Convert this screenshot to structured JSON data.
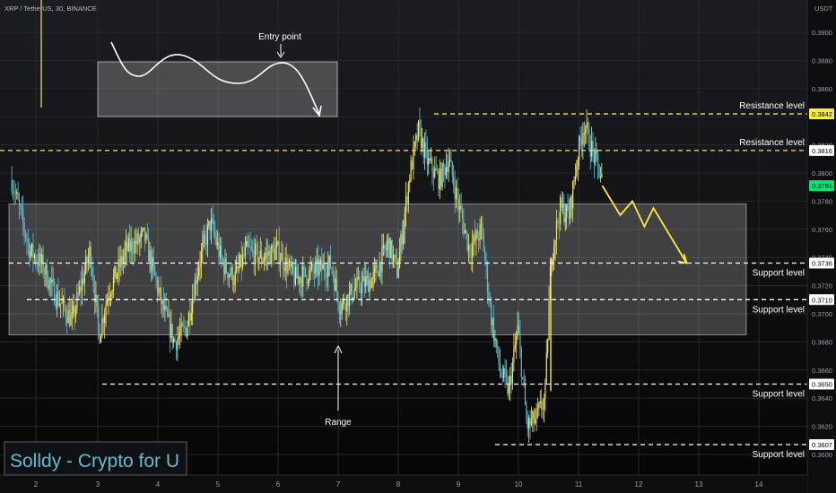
{
  "header": {
    "symbol_line": "XRP / TetherUS, 30, BINANCE"
  },
  "watermark": {
    "text": "Solldy - Crypto for U"
  },
  "price_axis": {
    "unit": "USDT",
    "ticks": [
      "0.3900",
      "0.3880",
      "0.3860",
      "0.3840",
      "0.3820",
      "0.3800",
      "0.3780",
      "0.3760",
      "0.3740",
      "0.3720",
      "0.3700",
      "0.3680",
      "0.3660",
      "0.3640",
      "0.3620",
      "0.3600"
    ]
  },
  "time_axis": {
    "labels": [
      "2",
      "3",
      "4",
      "5",
      "6",
      "7",
      "8",
      "9",
      "10",
      "11",
      "12",
      "13",
      "14"
    ]
  },
  "price_tags": [
    {
      "label": "0.3842",
      "value": 0.3842,
      "bg": "#ffeb3b",
      "fg": "#000000"
    },
    {
      "label": "0.3816",
      "value": 0.3816,
      "bg": "#ffffff",
      "fg": "#000000"
    },
    {
      "label": "0.3791",
      "value": 0.3791,
      "bg": "#00e676",
      "fg": "#000000"
    },
    {
      "label": "0.3736",
      "value": 0.3736,
      "bg": "#ffffff",
      "fg": "#000000"
    },
    {
      "label": "0.3710",
      "value": 0.371,
      "bg": "#ffffff",
      "fg": "#000000"
    },
    {
      "label": "0.3650",
      "value": 0.365,
      "bg": "#ffffff",
      "fg": "#000000"
    },
    {
      "label": "0.3607",
      "value": 0.3607,
      "bg": "#ffffff",
      "fg": "#000000"
    }
  ],
  "annotations": {
    "entry_point": "Entry point",
    "range": "Range",
    "resistance_1": "Resistance level",
    "resistance_2": "Resistance level",
    "support_1": "Support level",
    "support_2": "Support level",
    "support_3": "Support level",
    "support_4": "Support level"
  },
  "colors": {
    "background": "#0b0b0d",
    "bull": "#f5e663",
    "bear": "#5fbcd3",
    "resistance_line": "#ffeb3b",
    "support_line": "#ffffff",
    "projection": "#ffeb3b",
    "watermark": "#5fbcd3"
  },
  "chart_data": {
    "type": "line",
    "title": "XRP / TetherUS, 30, BINANCE",
    "ylabel": "USDT",
    "ylim": [
      0.3592,
      0.3915
    ],
    "x_labels": [
      "2",
      "3",
      "4",
      "5",
      "6",
      "7",
      "8",
      "9",
      "10",
      "11",
      "12",
      "13",
      "14"
    ],
    "series": [
      {
        "name": "XRP / TetherUS",
        "x": [
          1.6,
          1.9,
          2.1,
          2.3,
          2.6,
          2.9,
          3.05,
          3.2,
          3.5,
          3.8,
          4.1,
          4.3,
          4.5,
          4.7,
          4.9,
          5.1,
          5.3,
          5.5,
          5.75,
          6.0,
          6.3,
          6.6,
          6.9,
          7.05,
          7.3,
          7.6,
          7.85,
          8.0,
          8.2,
          8.35,
          8.5,
          8.7,
          8.85,
          9.0,
          9.2,
          9.4,
          9.55,
          9.7,
          9.85,
          10.0,
          10.15,
          10.3,
          10.45,
          10.55,
          10.7,
          10.85,
          11.0,
          11.1,
          11.2,
          11.4
        ],
        "values": [
          0.3795,
          0.3745,
          0.3735,
          0.3715,
          0.3695,
          0.3745,
          0.3685,
          0.3715,
          0.3745,
          0.3755,
          0.3705,
          0.368,
          0.369,
          0.3735,
          0.3765,
          0.3735,
          0.3725,
          0.3745,
          0.374,
          0.3745,
          0.3725,
          0.373,
          0.3735,
          0.3705,
          0.3718,
          0.3725,
          0.375,
          0.373,
          0.3798,
          0.383,
          0.3808,
          0.3795,
          0.381,
          0.378,
          0.3745,
          0.376,
          0.37,
          0.366,
          0.3645,
          0.369,
          0.362,
          0.3625,
          0.364,
          0.374,
          0.3775,
          0.377,
          0.3815,
          0.3835,
          0.382,
          0.3795
        ]
      }
    ],
    "horizontal_levels": [
      0.3842,
      0.3816,
      0.3736,
      0.371,
      0.365,
      0.3607
    ],
    "range_box": [
      0.3685,
      0.3778
    ],
    "projection": {
      "x": [
        11.4,
        11.7,
        11.9,
        12.1,
        12.25,
        12.8
      ],
      "values": [
        0.3791,
        0.377,
        0.378,
        0.3762,
        0.3775,
        0.3736
      ]
    },
    "grid": true
  }
}
